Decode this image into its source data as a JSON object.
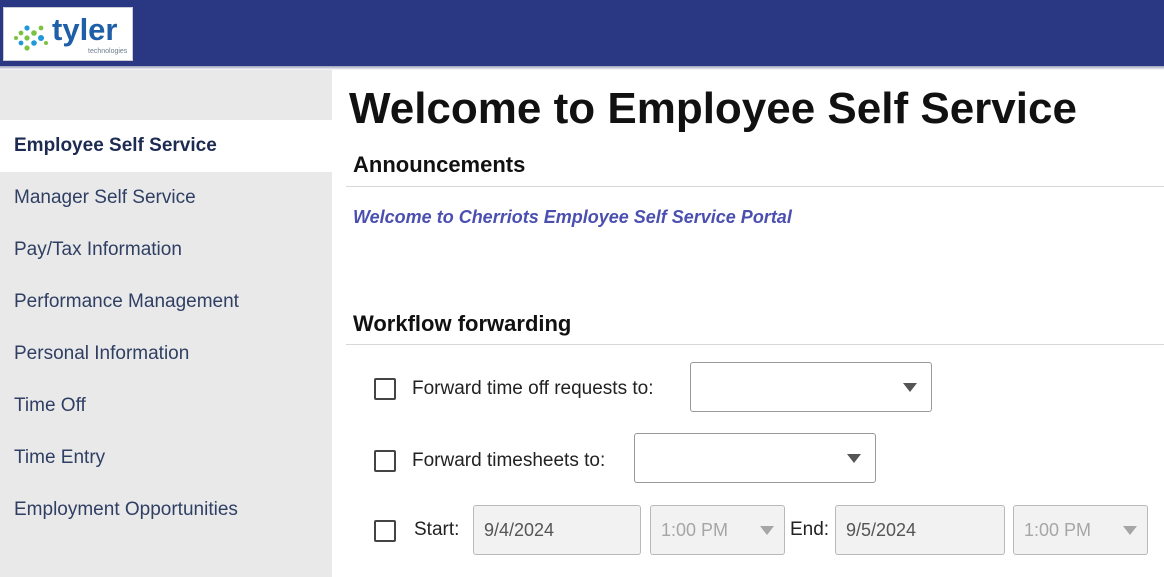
{
  "brand": {
    "name": "tyler",
    "subtitle": "technologies",
    "header_color": "#2a3782"
  },
  "sidebar": {
    "items": [
      {
        "label": "Employee Self Service",
        "active": true
      },
      {
        "label": "Manager Self Service"
      },
      {
        "label": "Pay/Tax Information"
      },
      {
        "label": "Performance Management"
      },
      {
        "label": "Personal Information"
      },
      {
        "label": "Time Off"
      },
      {
        "label": "Time Entry"
      },
      {
        "label": "Employment Opportunities"
      }
    ]
  },
  "main": {
    "title": "Welcome to Employee Self Service",
    "announcements": {
      "heading": "Announcements",
      "message": "Welcome to Cherriots  Employee Self  Service Portal"
    },
    "workflow": {
      "heading": "Workflow forwarding",
      "time_off_label": "Forward time off requests to:",
      "time_off_value": "",
      "timesheets_label": "Forward timesheets to:",
      "timesheets_value": "",
      "start_label": "Start:",
      "start_date": "9/4/2024",
      "start_time": "1:00 PM",
      "end_label": "End:",
      "end_date": "9/5/2024",
      "end_time": "1:00 PM"
    }
  }
}
